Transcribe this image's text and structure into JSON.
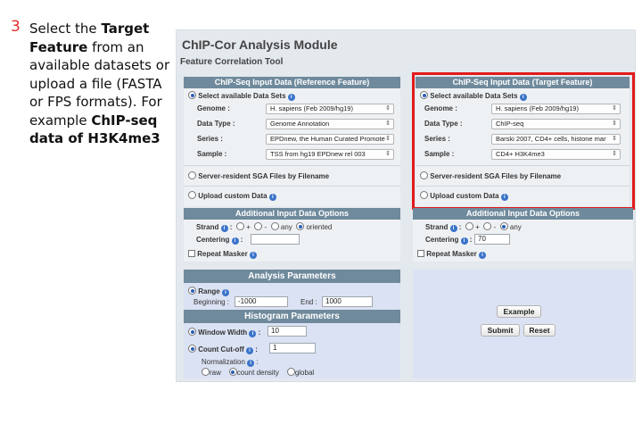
{
  "annotation": {
    "step_number": "3",
    "t1": "Select the ",
    "b1": "Target Feature",
    "t2": " from an available datasets or upload a file (FASTA or FPS formats). For example ",
    "b2": "ChIP-seq data of H3K4me3"
  },
  "module": {
    "title": "ChIP-Cor Analysis Module",
    "subtitle": "Feature Correlation Tool"
  },
  "reference": {
    "header": "ChIP-Seq Input Data (Reference Feature)",
    "select_label": "Select available Data Sets",
    "genome_label": "Genome :",
    "genome_value": "H. sapiens (Feb 2009/hg19)",
    "datatype_label": "Data Type :",
    "datatype_value": "Genome Annotation",
    "series_label": "Series :",
    "series_value": "EPDnew, the Human Curated Promote",
    "sample_label": "Sample :",
    "sample_value": "TSS from hg19 EPDnew rel 003",
    "server_label": "Server-resident SGA Files by Filename",
    "upload_label": "Upload custom Data"
  },
  "target": {
    "header": "ChIP-Seq Input Data (Target Feature)",
    "select_label": "Select available Data Sets",
    "genome_label": "Genome :",
    "genome_value": "H. sapiens (Feb 2009/hg19)",
    "datatype_label": "Data Type :",
    "datatype_value": "ChIP-seq",
    "series_label": "Series :",
    "series_value": "Barski 2007, CD4+ cells, histone mar",
    "sample_label": "Sample :",
    "sample_value": "CD4+ H3K4me3",
    "server_label": "Server-resident SGA Files by Filename",
    "upload_label": "Upload custom Data"
  },
  "ref_options": {
    "header": "Additional Input Data Options",
    "strand_label": "Strand",
    "opt_plus": "+",
    "opt_minus": "-",
    "opt_any": "any",
    "opt_oriented": "oriented",
    "centering_label": "Centering",
    "centering_value": "",
    "repeat_label": "Repeat Masker"
  },
  "tgt_options": {
    "header": "Additional Input Data Options",
    "strand_label": "Strand",
    "opt_plus": "+",
    "opt_minus": "-",
    "opt_any": "any",
    "centering_label": "Centering",
    "centering_value": "70",
    "repeat_label": "Repeat Masker"
  },
  "analysis": {
    "header": "Analysis Parameters",
    "range_label": "Range",
    "beginning_label": "Beginning :",
    "beginning_value": "-1000",
    "end_label": "End :",
    "end_value": "1000"
  },
  "histogram": {
    "header": "Histogram Parameters",
    "window_label": "Window Width",
    "window_value": "10",
    "cutoff_label": "Count Cut-off",
    "cutoff_value": "1",
    "norm_label": "Normalization",
    "norm_raw": "raw",
    "norm_count": "count density",
    "norm_global": "global"
  },
  "buttons": {
    "example": "Example",
    "submit": "Submit",
    "reset": "Reset"
  }
}
